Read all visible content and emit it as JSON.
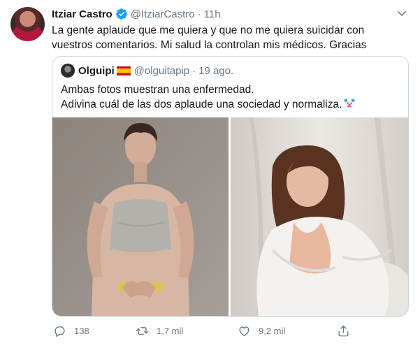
{
  "tweet": {
    "author_name": "Itziar Castro",
    "handle": "@ItziarCastro",
    "separator": "·",
    "time": "11h",
    "text": "La gente aplaude que me quiera y que no me quiera suicidar con vuestros comentarios. Mi salud la controlan mis médicos. Gracias"
  },
  "quoted": {
    "author_name": "Olguipi",
    "flag_icon": "spain-flag-icon",
    "handle": "@olguitapip",
    "separator": "·",
    "time": "19 ago.",
    "line1": "Ambas fotos muestran una enfermedad.",
    "line2": "Adivina cuál de las dos aplaude una sociedad y normaliza."
  },
  "actions": {
    "reply_count": "138",
    "retweet_count": "1,7 mil",
    "like_count": "9,2 mil"
  },
  "colors": {
    "text": "#14171a",
    "secondary": "#657786",
    "verified": "#1da1f2",
    "border": "#ccd6dd"
  }
}
